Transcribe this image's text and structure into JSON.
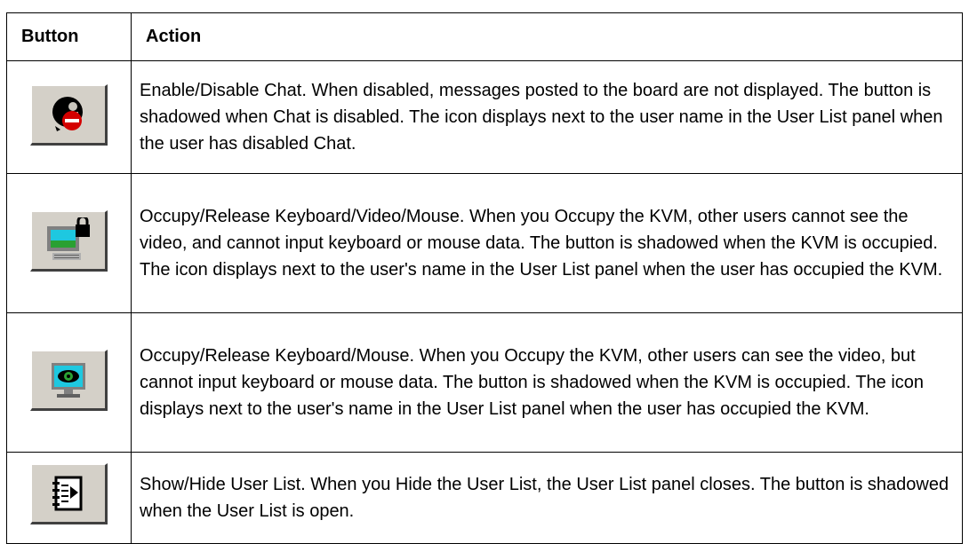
{
  "table": {
    "headers": {
      "button": "Button",
      "action": "Action"
    },
    "rows": [
      {
        "icon": "chat-disabled-icon",
        "action": "Enable/Disable Chat. When disabled, messages posted to the board are not displayed. The button is shadowed when Chat is disabled. The icon displays next to the user name in the User List panel when the user has disabled Chat."
      },
      {
        "icon": "kvm-occupy-locked-icon",
        "action": "Occupy/Release Keyboard/Video/Mouse. When you Occupy the KVM, other users cannot see the video, and cannot input keyboard or mouse data. The button is shadowed when the KVM is occupied. The icon displays next to the user's name in the User List panel when the user has occupied the KVM."
      },
      {
        "icon": "keyboard-mouse-occupy-icon",
        "action": "Occupy/Release Keyboard/Mouse. When you Occupy the KVM, other users can see the video, but cannot input keyboard or mouse data. The button is shadowed when the KVM is occupied. The icon displays next to the user's name in the User List panel when the user has occupied the KVM."
      },
      {
        "icon": "user-list-toggle-icon",
        "action": "Show/Hide User List. When you Hide the User List, the User List panel closes. The button is shadowed when the User List is open."
      }
    ]
  }
}
